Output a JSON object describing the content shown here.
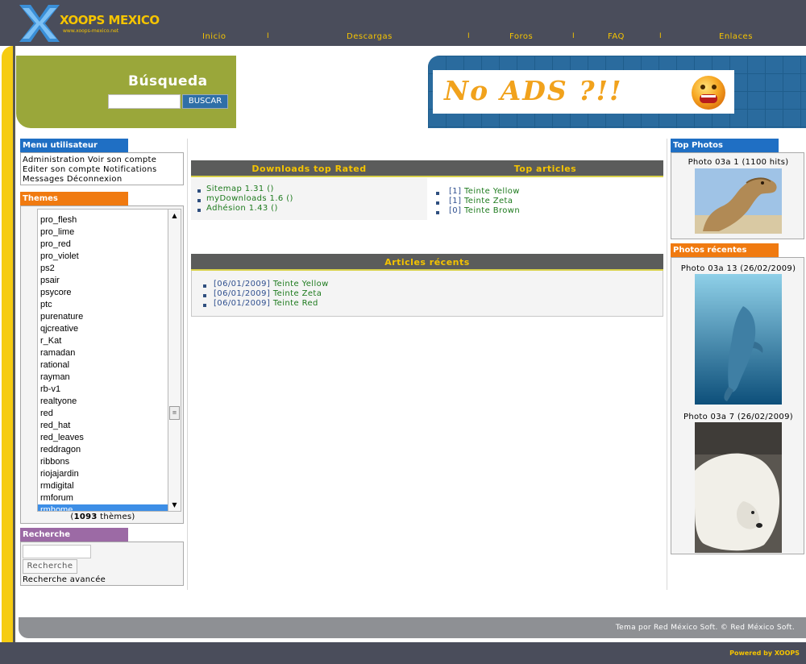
{
  "header": {
    "logo_text": "XOOPS MEXICO",
    "logo_sub": "www.xoops-mexico.net",
    "nav": [
      "Inicio",
      "Descargas",
      "Foros",
      "FAQ",
      "Enlaces"
    ],
    "nav_separator": "I"
  },
  "search": {
    "title": "Búsqueda",
    "input_value": "",
    "button_label": "BUSCAR"
  },
  "ad": {
    "text": "No ADS ?!!",
    "icon": "shocked-smiley-icon"
  },
  "menu_block": {
    "title": "Menu utilisateur",
    "lines": [
      "Administration Voir son compte",
      "Editer son compte Notifications",
      "Messages Déconnexion"
    ]
  },
  "themes_block": {
    "title": "Themes",
    "items": [
      "pro_flesh",
      "pro_lime",
      "pro_red",
      "pro_violet",
      "ps2",
      "psair",
      "psycore",
      "ptc",
      "purenature",
      "qjcreative",
      "r_Kat",
      "ramadan",
      "rational",
      "rayman",
      "rb-v1",
      "realtyone",
      "red",
      "red_hat",
      "red_leaves",
      "reddragon",
      "ribbons",
      "riojajardin",
      "rmdigital",
      "rmforum",
      "rmhome"
    ],
    "selected": "rmhome",
    "count": "1093",
    "count_suffix": " thèmes)",
    "count_prefix": "("
  },
  "recherche_block": {
    "title": "Recherche",
    "input_value": "",
    "button_label": "Recherche",
    "advanced": "Recherche avancée"
  },
  "downloads": {
    "title": "Downloads top Rated",
    "items": [
      "Sitemap 1.31 ()",
      "myDownloads 1.6 ()",
      "Adhésion 1.43 ()"
    ]
  },
  "top_articles": {
    "title": "Top articles",
    "items": [
      {
        "count": "[1]",
        "name": "Teinte Yellow"
      },
      {
        "count": "[1]",
        "name": "Teinte Zeta"
      },
      {
        "count": "[0]",
        "name": "Teinte Brown"
      }
    ]
  },
  "recent_articles": {
    "title": "Articles récents",
    "items": [
      {
        "date": "[06/01/2009]",
        "name": "Teinte Yellow"
      },
      {
        "date": "[06/01/2009]",
        "name": "Teinte Zeta"
      },
      {
        "date": "[06/01/2009]",
        "name": "Teinte Red"
      }
    ]
  },
  "top_photos": {
    "title": "Top Photos",
    "caption": "Photo 03a 1 (1100 hits)",
    "image": "camel-photo"
  },
  "recent_photos": {
    "title": "Photos récentes",
    "items": [
      {
        "caption": "Photo 03a 13 (26/02/2009)",
        "image": "dolphin-photo"
      },
      {
        "caption": "Photo 03a 7 (26/02/2009)",
        "image": "polar-bear-photo"
      }
    ]
  },
  "footer": {
    "credit": "Tema por Red México Soft. © Red México Soft.",
    "powered": "Powered by XOOPS"
  },
  "colors": {
    "topbar": "#4a4d5b",
    "accent_yellow": "#f5c400",
    "search_green": "#9aa73a",
    "menu_blue": "#1f6fc4",
    "themes_orange": "#f07a10",
    "recherche_purple": "#9c6aa5",
    "photos_orange": "#f07a10"
  }
}
